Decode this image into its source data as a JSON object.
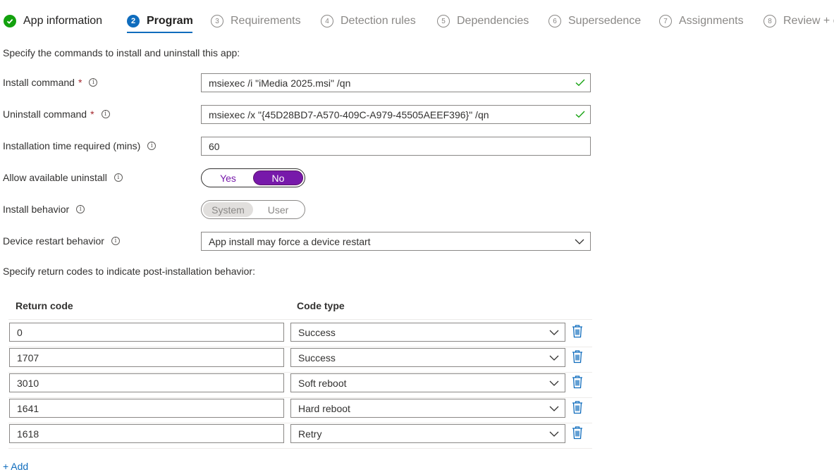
{
  "steps": [
    {
      "label": "App information",
      "number": "",
      "state": "done"
    },
    {
      "label": "Program",
      "number": "2",
      "state": "active"
    },
    {
      "label": "Requirements",
      "number": "3",
      "state": "todo"
    },
    {
      "label": "Detection rules",
      "number": "4",
      "state": "todo"
    },
    {
      "label": "Dependencies",
      "number": "5",
      "state": "todo"
    },
    {
      "label": "Supersedence",
      "number": "6",
      "state": "todo"
    },
    {
      "label": "Assignments",
      "number": "7",
      "state": "todo"
    },
    {
      "label": "Review + create",
      "number": "8",
      "state": "todo"
    }
  ],
  "intro": "Specify the commands to install and uninstall this app:",
  "fields": {
    "install_command": {
      "label": "Install command",
      "required_mark": "*",
      "value": "msiexec /i \"iMedia 2025.msi\" /qn",
      "valid": true
    },
    "uninstall_command": {
      "label": "Uninstall command",
      "required_mark": "*",
      "value": "msiexec /x \"{45D28BD7-A570-409C-A979-45505AEEF396}\" /qn",
      "valid": true
    },
    "install_time": {
      "label": "Installation time required (mins)",
      "value": "60"
    },
    "allow_uninstall": {
      "label": "Allow available uninstall",
      "options": [
        "Yes",
        "No"
      ],
      "selected": "No"
    },
    "install_behavior": {
      "label": "Install behavior",
      "options": [
        "System",
        "User"
      ],
      "selected": "System",
      "disabled": true
    },
    "restart_behavior": {
      "label": "Device restart behavior",
      "value": "App install may force a device restart"
    }
  },
  "return_codes": {
    "intro": "Specify return codes to indicate post-installation behavior:",
    "col_code": "Return code",
    "col_type": "Code type",
    "rows": [
      {
        "code": "0",
        "type": "Success"
      },
      {
        "code": "1707",
        "type": "Success"
      },
      {
        "code": "3010",
        "type": "Soft reboot"
      },
      {
        "code": "1641",
        "type": "Hard reboot"
      },
      {
        "code": "1618",
        "type": "Retry"
      }
    ],
    "add_label": "+ Add"
  },
  "colors": {
    "accent": "#0f6cbd",
    "success": "#13a10e",
    "toggle_selected": "#7719aa",
    "required": "#a4262c",
    "trash": "#0f6cbd"
  },
  "icons": {
    "done_step": "checkmark-circle-icon",
    "valid": "checkmark-icon",
    "info": "info-icon",
    "dropdown": "chevron-down-icon",
    "delete": "trash-icon"
  }
}
